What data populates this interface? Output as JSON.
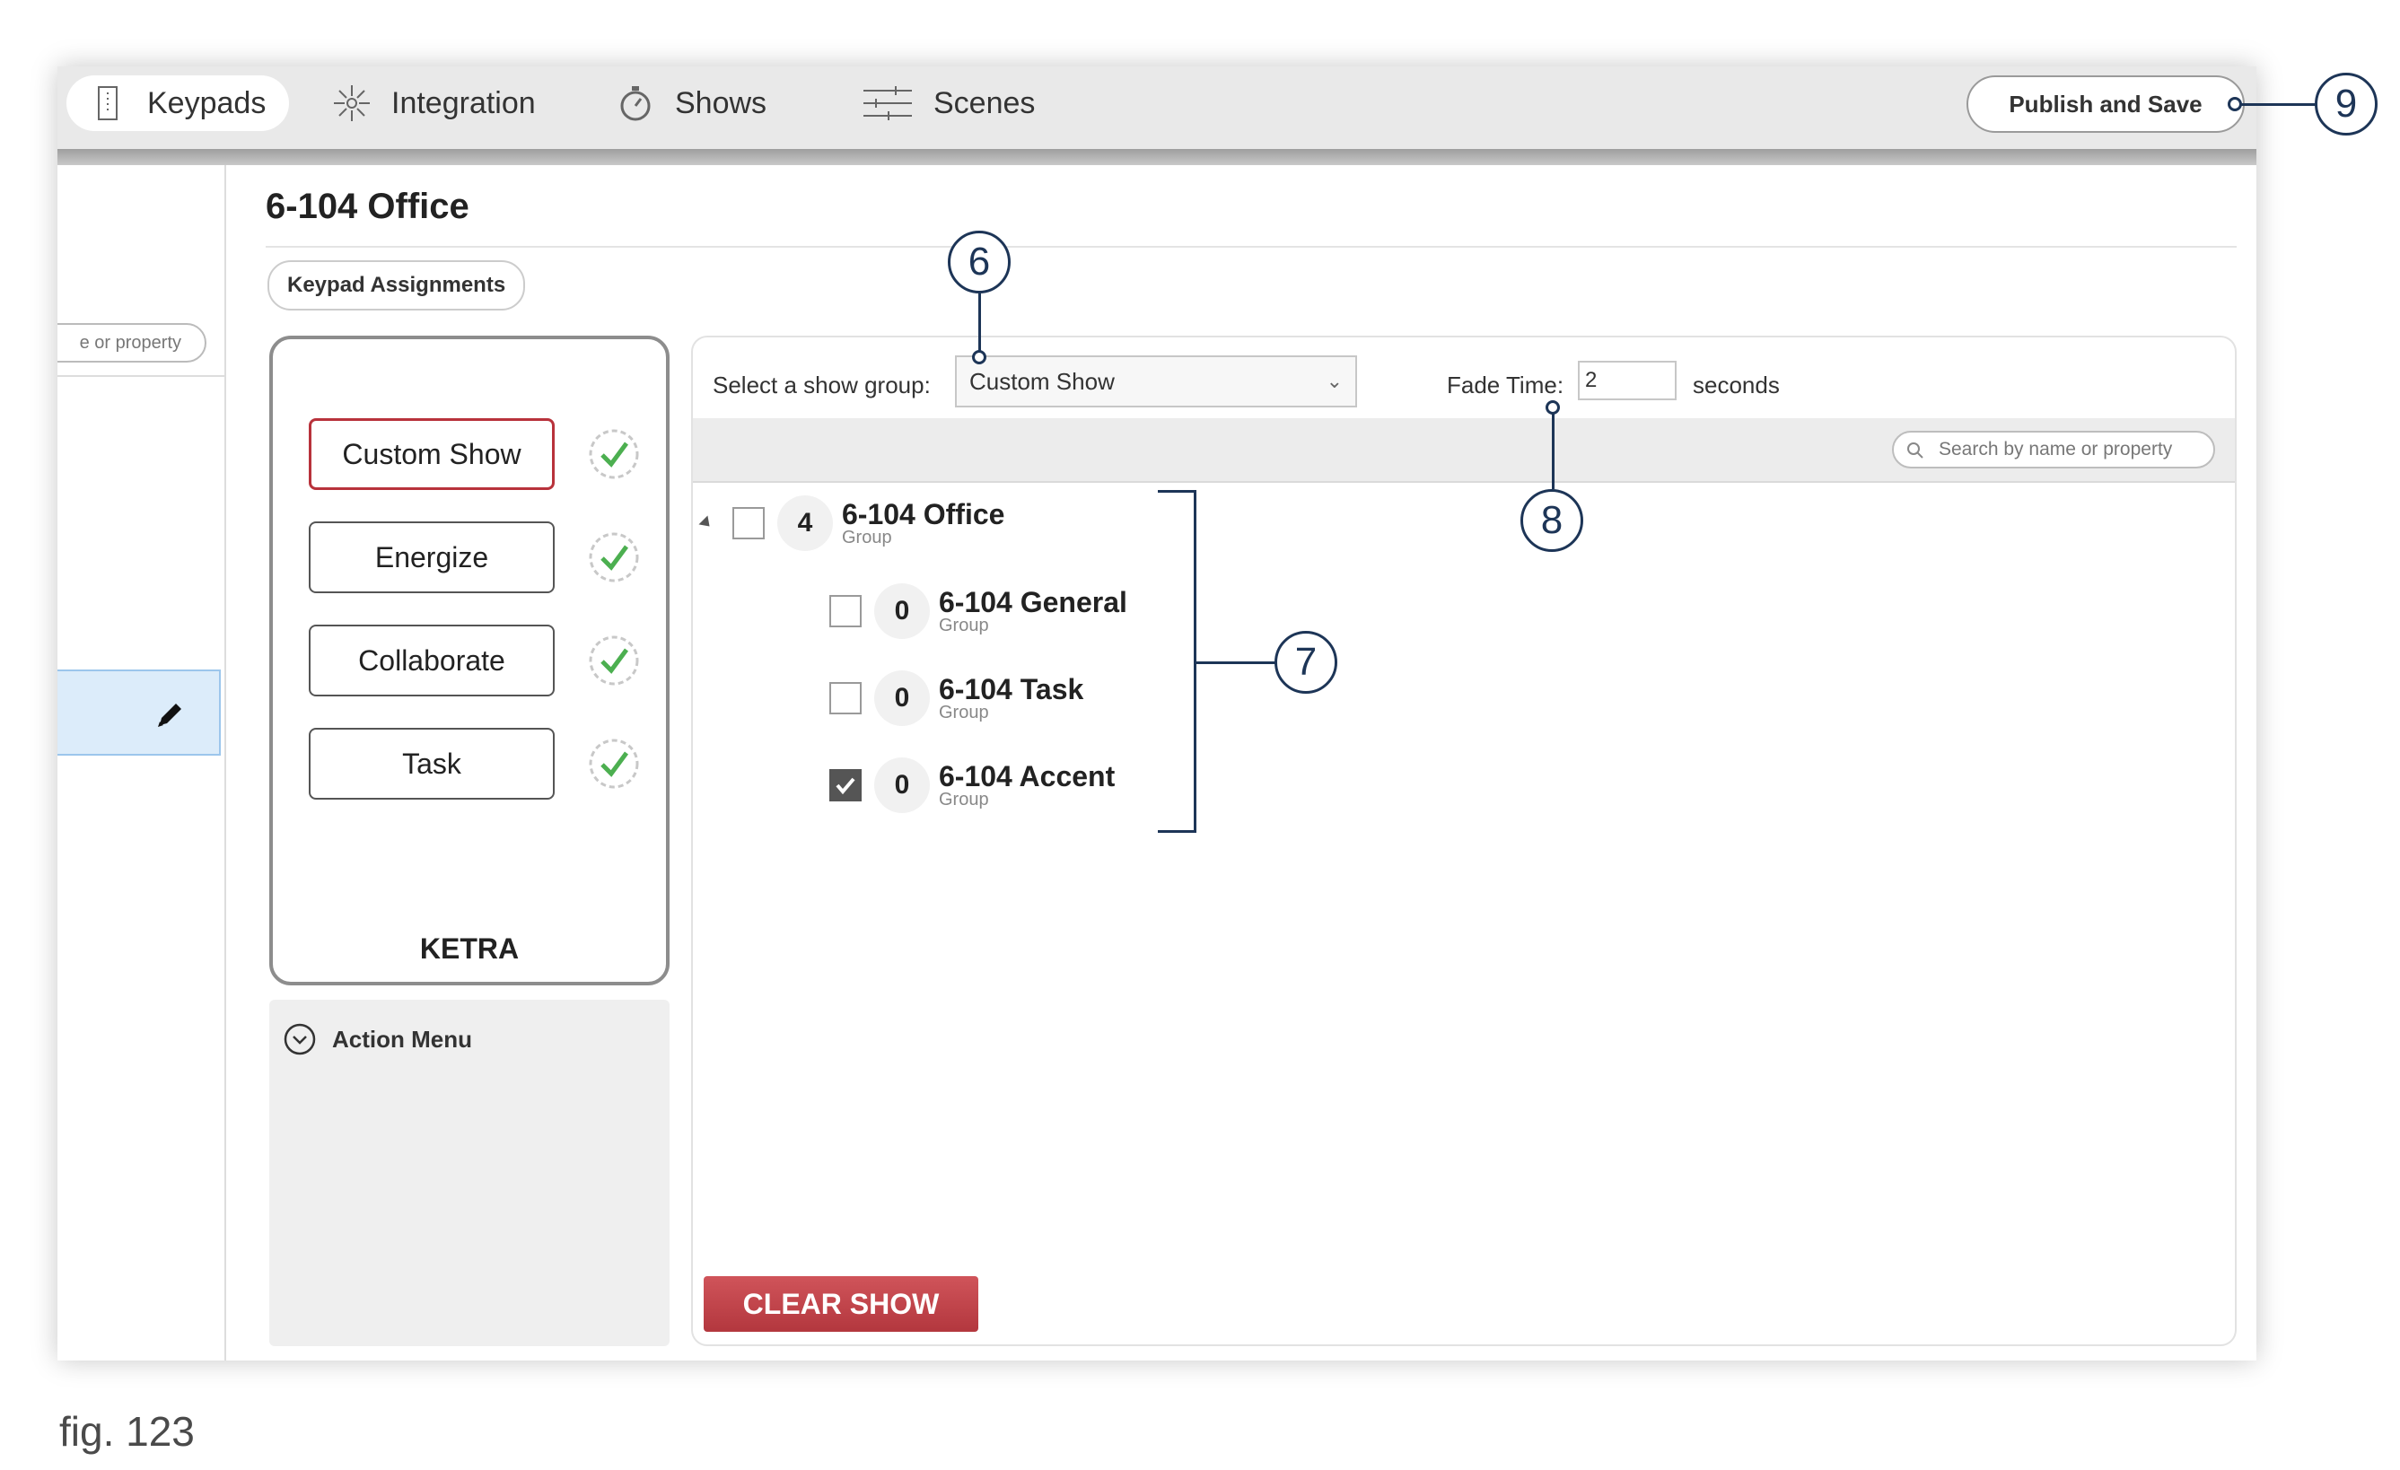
{
  "nav": {
    "tabs": [
      {
        "label": "Keypads",
        "icon": "keypad-icon"
      },
      {
        "label": "Integration",
        "icon": "integration-icon"
      },
      {
        "label": "Shows",
        "icon": "stopwatch-icon"
      },
      {
        "label": "Scenes",
        "icon": "sliders-icon"
      }
    ],
    "active_tab": "Keypads",
    "publish_label": "Publish and Save"
  },
  "left_panel": {
    "search_placeholder": "e or property"
  },
  "room": {
    "title": "6-104 Office",
    "assignments_button": "Keypad Assignments"
  },
  "keypad": {
    "buttons": [
      "Custom Show",
      "Energize",
      "Collaborate",
      "Task"
    ],
    "selected": "Custom Show",
    "brand": "KETRA",
    "action_menu": "Action Menu"
  },
  "show_panel": {
    "show_group_label": "Select a show group:",
    "show_group_value": "Custom Show",
    "fade_label": "Fade Time:",
    "fade_value": "2",
    "fade_unit": "seconds",
    "search_placeholder": "Search by name or property",
    "tree": {
      "parent": {
        "count": "4",
        "name": "6-104 Office",
        "type": "Group",
        "checked": false
      },
      "children": [
        {
          "count": "0",
          "name": "6-104 General",
          "type": "Group",
          "checked": false
        },
        {
          "count": "0",
          "name": "6-104 Task",
          "type": "Group",
          "checked": false
        },
        {
          "count": "0",
          "name": "6-104 Accent",
          "type": "Group",
          "checked": true
        }
      ]
    },
    "clear_label": "CLEAR SHOW"
  },
  "callouts": [
    "6",
    "7",
    "8",
    "9"
  ],
  "caption": "fig. 123",
  "colors": {
    "accent_red": "#b8323b",
    "callout_navy": "#1d3557",
    "selected_row": "#dcecfa"
  }
}
